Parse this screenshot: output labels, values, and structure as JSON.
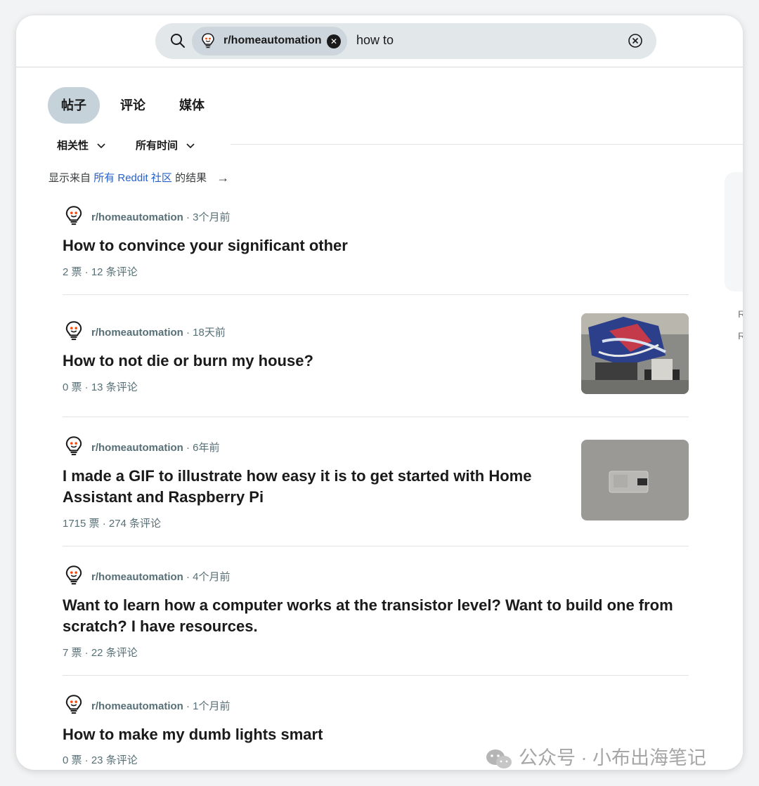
{
  "search": {
    "chip_label": "r/homeautomation",
    "query": "how to"
  },
  "tabs": [
    {
      "label": "帖子",
      "active": true
    },
    {
      "label": "评论",
      "active": false
    },
    {
      "label": "媒体",
      "active": false
    }
  ],
  "filters": {
    "sort": "相关性",
    "time": "所有时间"
  },
  "all_reddit": {
    "prefix": "显示来自",
    "link": "所有 Reddit 社区",
    "suffix": "的结果"
  },
  "posts": [
    {
      "subreddit": "r/homeautomation",
      "time": " · 3个月前",
      "title": "How to convince your significant other",
      "stats": "2 票 · 12 条评论",
      "has_thumb": false
    },
    {
      "subreddit": "r/homeautomation",
      "time": " · 18天前",
      "title": "How to not die or burn my house?",
      "stats": "0 票 · 13 条评论",
      "has_thumb": true
    },
    {
      "subreddit": "r/homeautomation",
      "time": " · 6年前",
      "title": "I made a GIF to illustrate how easy it is to get started with Home Assistant and Raspberry Pi",
      "stats": "1715 票 · 274 条评论",
      "has_thumb": true
    },
    {
      "subreddit": "r/homeautomation",
      "time": " · 4个月前",
      "title": "Want to learn how a computer works at the transistor level? Want to build one from scratch? I have resources.",
      "stats": "7 票 · 22 条评论",
      "has_thumb": false
    },
    {
      "subreddit": "r/homeautomation",
      "time": " · 1个月前",
      "title": "How to make my dumb lights smart",
      "stats": "0 票 · 23 条评论",
      "has_thumb": false
    }
  ],
  "right_panel": {
    "r1": "R",
    "r2": "R"
  },
  "watermark": "公众号 · 小布出海笔记"
}
